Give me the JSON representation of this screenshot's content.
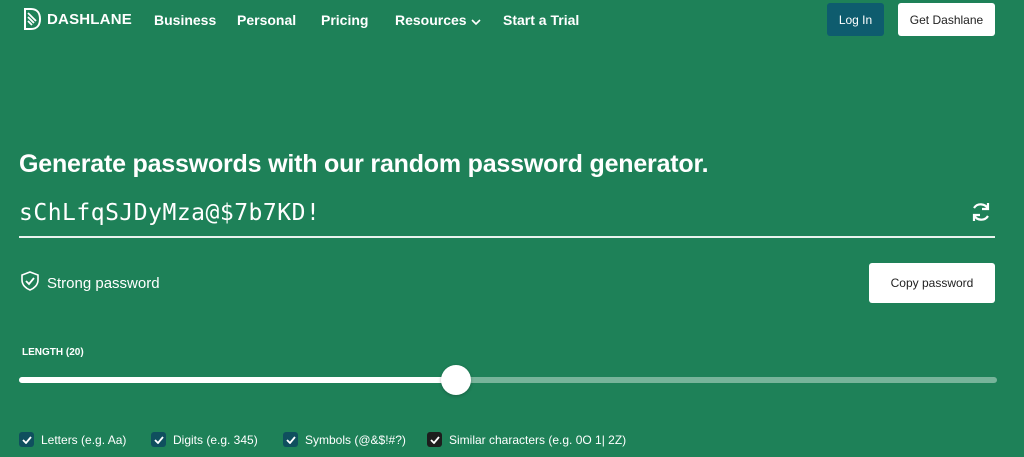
{
  "nav": {
    "logo_text": "DASHLANE",
    "links": [
      "Business",
      "Personal",
      "Pricing",
      "Resources",
      "Start a Trial"
    ],
    "login_label": "Log In",
    "get_label": "Get Dashlane"
  },
  "hero": {
    "headline": "Generate passwords with our random password generator.",
    "password": "sChLfqSJDyMza@$7b7KD!",
    "strength": "Strong password",
    "copy_label": "Copy password",
    "length_label": "LENGTH (20)",
    "length_fraction": 0.447
  },
  "options": [
    {
      "label": "Letters (e.g. Aa)",
      "checked": true
    },
    {
      "label": "Digits (e.g. 345)",
      "checked": true
    },
    {
      "label": "Symbols (@&$!#?)",
      "checked": true
    },
    {
      "label": "Similar characters (e.g. 0O 1| 2Z)",
      "checked": true
    }
  ],
  "colors": {
    "background": "#1e8158",
    "login_button": "#0e5c6e",
    "checkbox": "#0f4f5e"
  },
  "icons": [
    "dashlane-logo-icon",
    "chevron-down-icon",
    "refresh-icon",
    "shield-check-icon",
    "checkmark-icon"
  ]
}
